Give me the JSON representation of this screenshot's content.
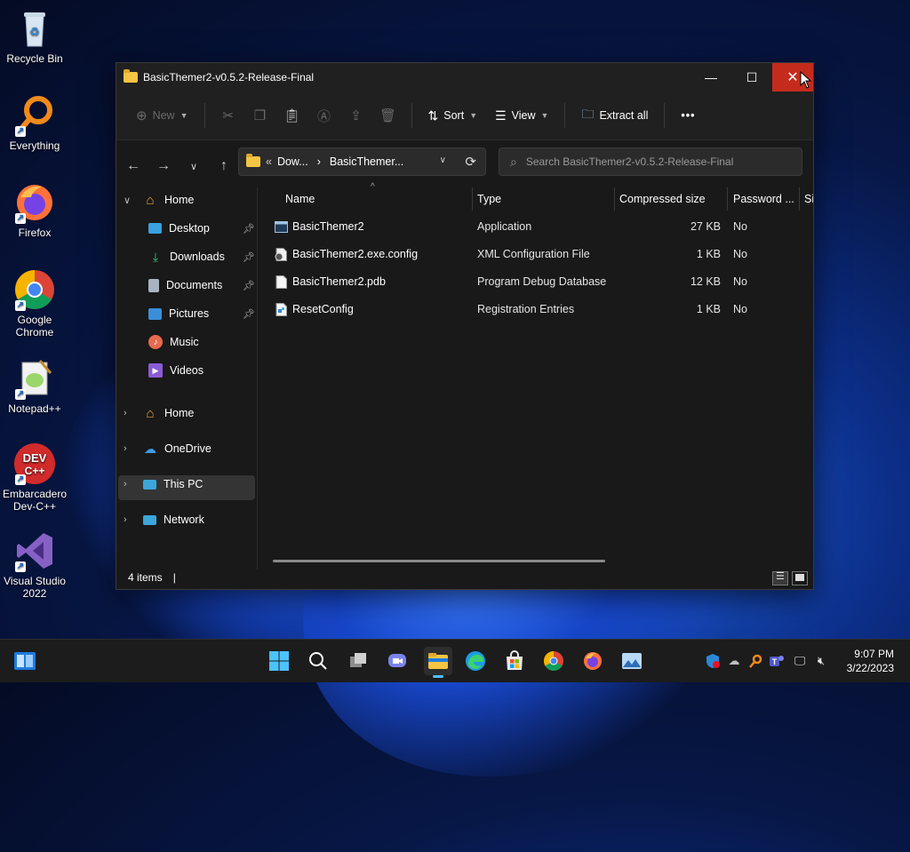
{
  "desktop": {
    "icons": [
      {
        "label": "Recycle Bin",
        "icon": "recycle-bin-icon"
      },
      {
        "label": "Everything",
        "icon": "everything-icon"
      },
      {
        "label": "Firefox",
        "icon": "firefox-icon"
      },
      {
        "label": "Google Chrome",
        "icon": "chrome-icon"
      },
      {
        "label": "Notepad++",
        "icon": "notepad-plus-plus-icon"
      },
      {
        "label": "Embarcadero Dev-C++",
        "icon": "devcpp-icon"
      },
      {
        "label": "Visual Studio 2022",
        "icon": "visual-studio-icon"
      }
    ],
    "devcpp_logo": "DEV C++"
  },
  "window": {
    "title": "BasicThemer2-v0.5.2-Release-Final",
    "controls": {
      "minimize": "—",
      "maximize": "☐",
      "close": "✕"
    }
  },
  "toolbar": {
    "new_label": "New",
    "sort_label": "Sort",
    "view_label": "View",
    "extract_label": "Extract all",
    "more_label": "•••"
  },
  "address": {
    "prefix": "«",
    "crumb1": "Dow...",
    "separator": "›",
    "crumb2": "BasicThemer...",
    "search_placeholder": "Search BasicThemer2-v0.5.2-Release-Final"
  },
  "nav": {
    "home": "Home",
    "quick_access": [
      {
        "label": "Desktop",
        "pinned": true
      },
      {
        "label": "Downloads",
        "pinned": true
      },
      {
        "label": "Documents",
        "pinned": true
      },
      {
        "label": "Pictures",
        "pinned": true
      },
      {
        "label": "Music",
        "pinned": false
      },
      {
        "label": "Videos",
        "pinned": false
      }
    ],
    "roots": [
      {
        "label": "Home"
      },
      {
        "label": "OneDrive"
      },
      {
        "label": "This PC"
      },
      {
        "label": "Network"
      }
    ]
  },
  "columns": {
    "name": "Name",
    "type": "Type",
    "compressed_size": "Compressed size",
    "password": "Password ...",
    "size_partial": "Si"
  },
  "files": [
    {
      "name": "BasicThemer2",
      "type": "Application",
      "size": "27 KB",
      "password": "No",
      "icon": "application-icon"
    },
    {
      "name": "BasicThemer2.exe.config",
      "type": "XML Configuration File",
      "size": "1 KB",
      "password": "No",
      "icon": "config-file-icon"
    },
    {
      "name": "BasicThemer2.pdb",
      "type": "Program Debug Database",
      "size": "12 KB",
      "password": "No",
      "icon": "file-icon"
    },
    {
      "name": "ResetConfig",
      "type": "Registration Entries",
      "size": "1 KB",
      "password": "No",
      "icon": "registry-file-icon"
    }
  ],
  "status": {
    "item_count": "4 items",
    "sep": "|"
  },
  "taskbar": {
    "time": "9:07 PM",
    "date": "3/22/2023"
  },
  "colors": {
    "accent": "#0078d4",
    "close_hover": "#c42b1c",
    "folder": "#f4c443"
  }
}
